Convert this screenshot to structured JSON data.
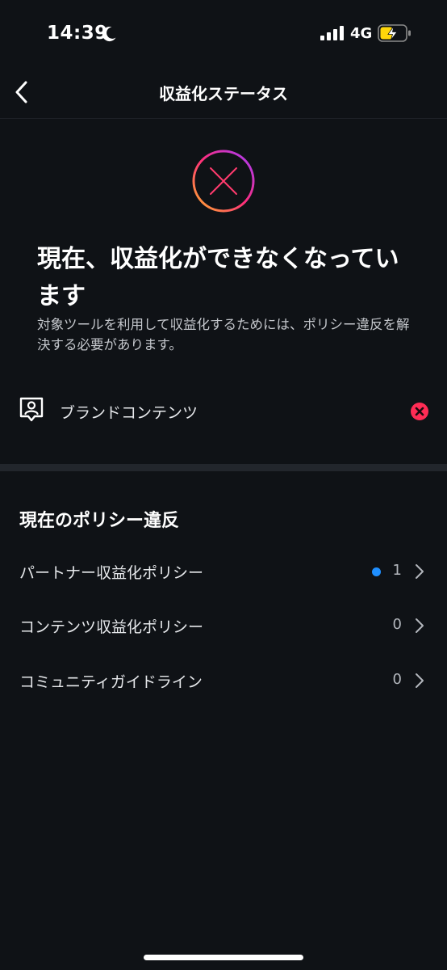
{
  "status_bar": {
    "time": "14:39",
    "network": "4G"
  },
  "nav": {
    "title": "収益化ステータス"
  },
  "status": {
    "headline": "現在、収益化ができなくなっています",
    "description": "対象ツールを利用して収益化するためには、ポリシー違反を解決する必要があります。"
  },
  "tools": [
    {
      "label": "ブランドコンテンツ"
    }
  ],
  "violations": {
    "title": "現在のポリシー違反",
    "items": [
      {
        "label": "パートナー収益化ポリシー",
        "count": "1"
      },
      {
        "label": "コンテンツ収益化ポリシー",
        "count": "0"
      },
      {
        "label": "コミュニティガイドライン",
        "count": "0"
      }
    ]
  },
  "colors": {
    "background": "#0f1216",
    "accent_blue": "#1f8fff",
    "error_red": "#ff2c55",
    "battery_yellow": "#ffd60a"
  }
}
